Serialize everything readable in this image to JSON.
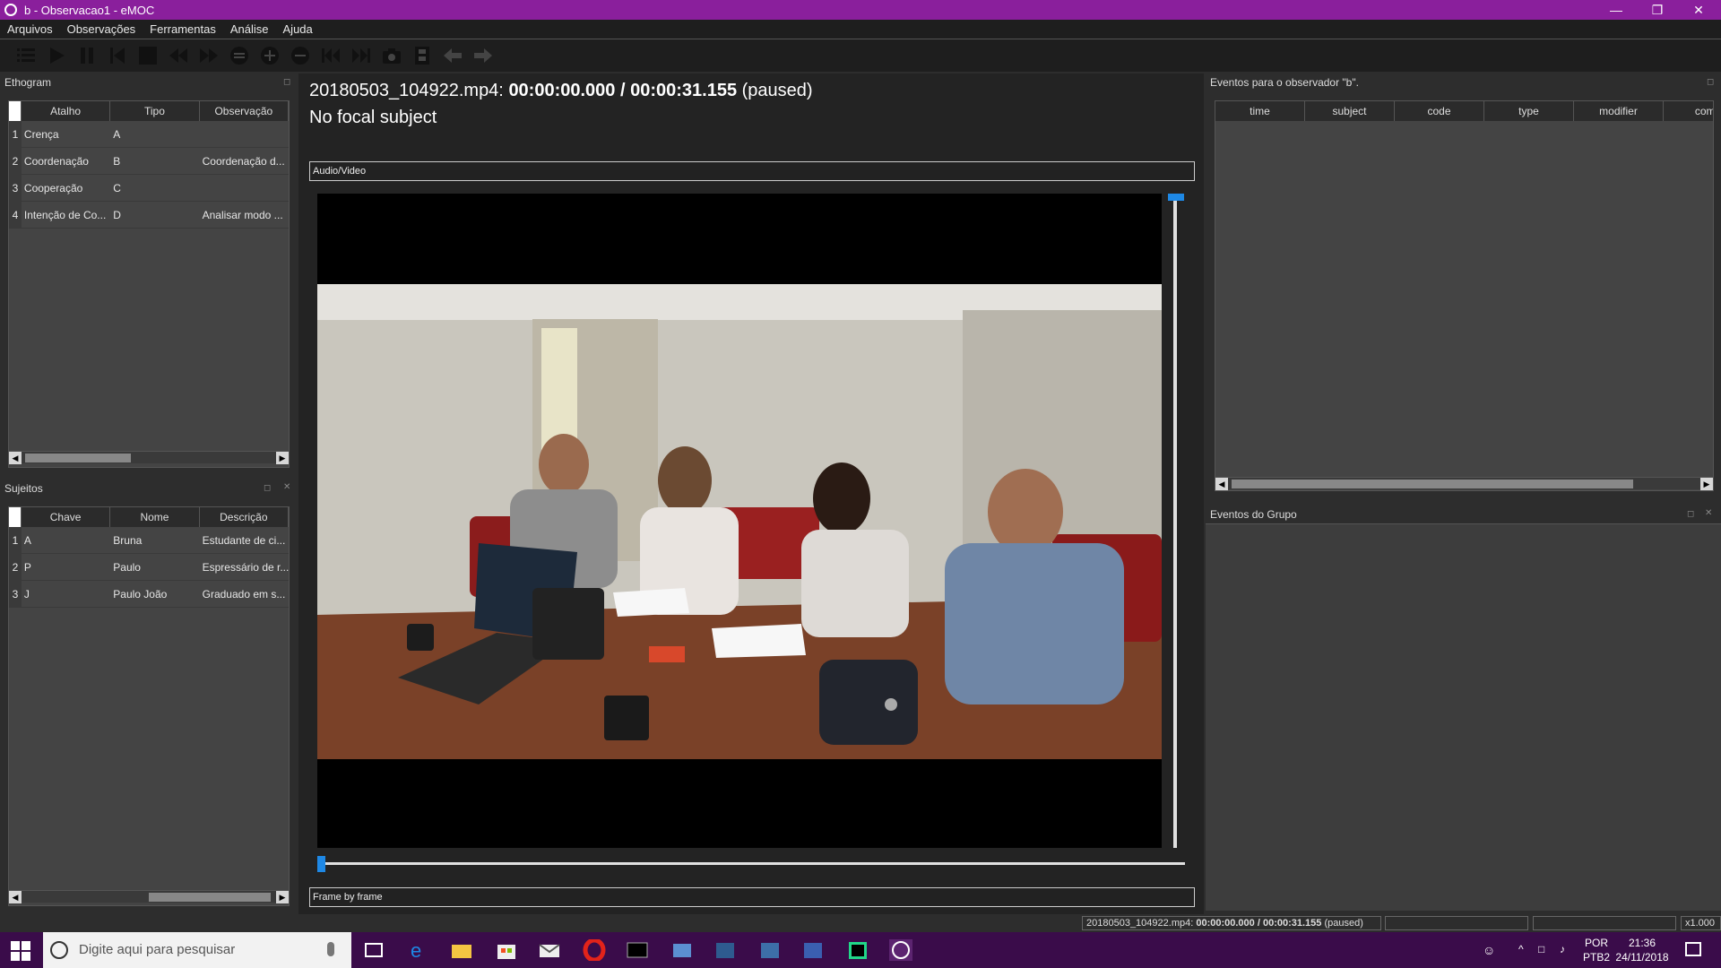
{
  "window": {
    "title": "b - Observacao1 - eMOC"
  },
  "menu": [
    "Arquivos",
    "Observações",
    "Ferramentas",
    "Análise",
    "Ajuda"
  ],
  "toolbar": {
    "icons": [
      "list-icon",
      "play-icon",
      "pause-icon",
      "skip-start-icon",
      "stop-icon",
      "rewind-icon",
      "fast-forward-icon",
      "equal-icon",
      "zoom-in-icon",
      "zoom-out-icon",
      "previous-icon",
      "next-icon",
      "camera-icon",
      "film-icon",
      "back-arrow-icon",
      "forward-arrow-icon"
    ]
  },
  "ethogram": {
    "title": "Ethogram",
    "columns": [
      "Atalho",
      "Tipo",
      "Observação"
    ],
    "rows": [
      {
        "n": "1",
        "atalho": "Crença",
        "tipo": "A",
        "obs": ""
      },
      {
        "n": "2",
        "atalho": "Coordenação",
        "tipo": "B",
        "obs": "Coordenação d..."
      },
      {
        "n": "3",
        "atalho": "Cooperação",
        "tipo": "C",
        "obs": ""
      },
      {
        "n": "4",
        "atalho": "Intenção de Co...",
        "tipo": "D",
        "obs": "Analisar modo ..."
      }
    ]
  },
  "subjects": {
    "title": "Sujeitos",
    "columns": [
      "Chave",
      "Nome",
      "Descrição"
    ],
    "rows": [
      {
        "n": "1",
        "chave": "A",
        "nome": "Bruna",
        "desc": "Estudante de ci..."
      },
      {
        "n": "2",
        "chave": "P",
        "nome": "Paulo",
        "desc": "Espressário de r..."
      },
      {
        "n": "3",
        "chave": "J",
        "nome": "Paulo João",
        "desc": "Graduado em s..."
      }
    ]
  },
  "player": {
    "file": "20180503_104922.mp4:",
    "time": "00:00:00.000 / 00:00:31.155",
    "state": "(paused)",
    "focal": "No focal subject",
    "tab_top": "Audio/Video",
    "tab_bottom": "Frame by frame"
  },
  "events": {
    "title": "Eventos para o observador \"b\".",
    "columns": [
      "time",
      "subject",
      "code",
      "type",
      "modifier",
      "comn"
    ]
  },
  "group_events": {
    "title": "Eventos do Grupo"
  },
  "status": {
    "file": "20180503_104922.mp4:",
    "time": "00:00:00.000 / 00:00:31.155",
    "state": "(paused)",
    "speed": "x1.000"
  },
  "taskbar": {
    "search_placeholder": "Digite aqui para pesquisar",
    "lang1": "POR",
    "lang2": "PTB2",
    "clock_time": "21:36",
    "clock_date": "24/11/2018"
  },
  "colors": {
    "titlebar": "#8a1f9c",
    "taskbar": "#3a0c4a",
    "accent": "#1e88e5"
  }
}
